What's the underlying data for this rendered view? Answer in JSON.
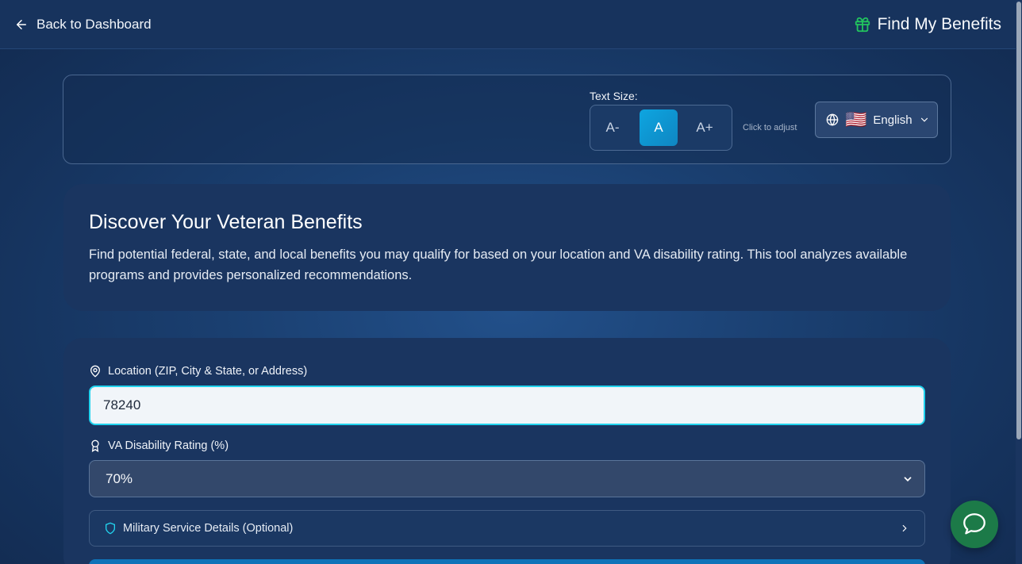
{
  "header": {
    "back_label": "Back to Dashboard",
    "title": "Find My Benefits"
  },
  "settings": {
    "text_size_label": "Text Size:",
    "size_decrease": "A-",
    "size_normal": "A",
    "size_increase": "A+",
    "hint": "Click to adjust",
    "language_flag": "🇺🇸",
    "language": "English"
  },
  "intro": {
    "title": "Discover Your Veteran Benefits",
    "text": "Find potential federal, state, and local benefits you may qualify for based on your location and VA disability rating. This tool analyzes available programs and provides personalized recommendations."
  },
  "form": {
    "location_label": "Location (ZIP, City & State, or Address)",
    "location_value": "78240",
    "rating_label": "VA Disability Rating (%)",
    "rating_value": "70%",
    "military_label": "Military Service Details (Optional)"
  },
  "colors": {
    "accent": "#22d3ee",
    "active_button": "#0ea5e0",
    "chat_button": "#1c7a48",
    "gift_icon": "#22c55e"
  }
}
